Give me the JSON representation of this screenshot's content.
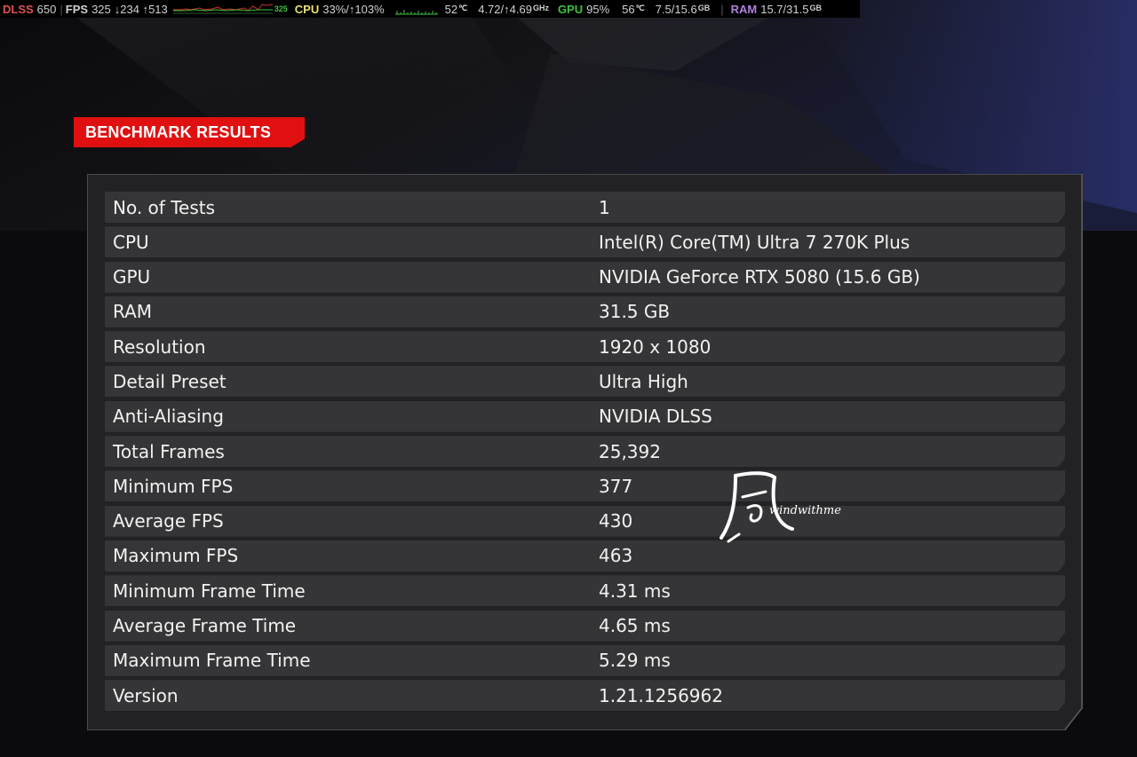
{
  "osd": {
    "dlss_label": "DLSS",
    "dlss_value": "650",
    "fps_label": "FPS",
    "fps_value": "325",
    "fps_low_high": "↓234 ↑513",
    "fps_graph_value": "325",
    "cpu_label": "CPU",
    "cpu_value": "33%/↑103%",
    "cpu_temp": "52",
    "cpu_temp_unit": "℃",
    "cpu_clock": "4.72/↑4.69",
    "cpu_clock_unit": "GHz",
    "gpu_label": "GPU",
    "gpu_value": "95%",
    "gpu_temp": "56",
    "gpu_temp_unit": "℃",
    "gpu_mem": "7.5/15.6",
    "gpu_mem_unit": "GB",
    "separator": "|",
    "ram_label": "RAM",
    "ram_value": "15.7/31.5",
    "ram_unit": "GB"
  },
  "title": "BENCHMARK RESULTS",
  "results": [
    {
      "label": "No. of Tests",
      "value": "1"
    },
    {
      "label": "CPU",
      "value": "Intel(R) Core(TM) Ultra 7 270K Plus"
    },
    {
      "label": "GPU",
      "value": "NVIDIA GeForce RTX 5080 (15.6 GB)"
    },
    {
      "label": "RAM",
      "value": "31.5 GB"
    },
    {
      "label": "Resolution",
      "value": "1920 x 1080"
    },
    {
      "label": "Detail Preset",
      "value": "Ultra High"
    },
    {
      "label": "Anti-Aliasing",
      "value": "NVIDIA DLSS"
    },
    {
      "label": "Total Frames",
      "value": "25,392"
    },
    {
      "label": "Minimum FPS",
      "value": "377"
    },
    {
      "label": "Average FPS",
      "value": "430"
    },
    {
      "label": "Maximum FPS",
      "value": "463"
    },
    {
      "label": "Minimum Frame Time",
      "value": "4.31 ms"
    },
    {
      "label": "Average Frame Time",
      "value": "4.65 ms"
    },
    {
      "label": "Maximum Frame Time",
      "value": "5.29 ms"
    },
    {
      "label": "Version",
      "value": "1.21.1256962"
    }
  ],
  "watermark": {
    "glyph": "風",
    "text": "windwithme"
  },
  "colors": {
    "accent_red": "#e01010",
    "panel_bg": "#222224",
    "row_bg": "#353537",
    "text": "#f2f2f2"
  }
}
